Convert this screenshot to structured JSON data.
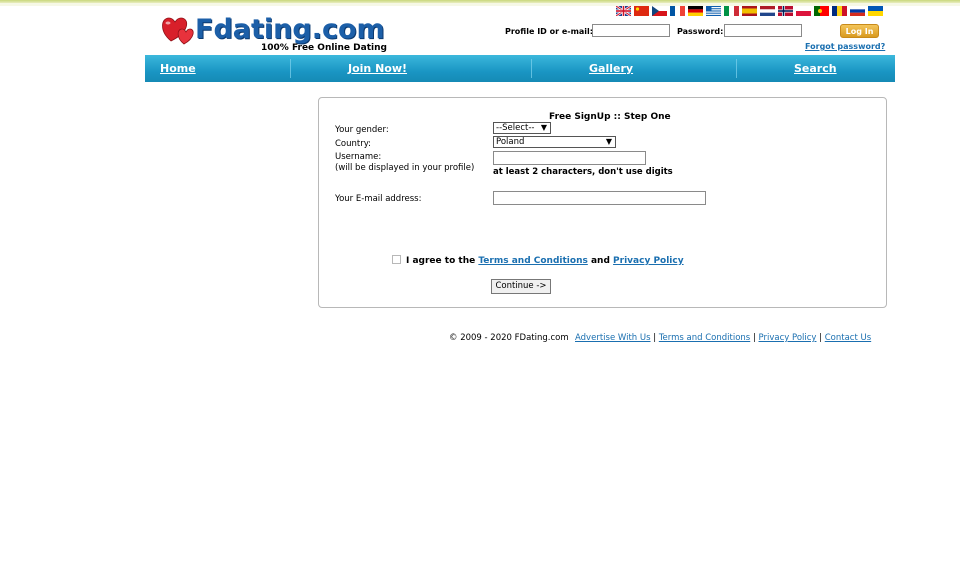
{
  "brand": {
    "logo_text": "Fdating.com",
    "tagline": "100% Free Online Dating"
  },
  "languages": [
    {
      "name": "english-flag-icon",
      "colors": [
        "#1d3f8f",
        "#ffffff",
        "#cf142b"
      ]
    },
    {
      "name": "chinese-flag-icon",
      "colors": [
        "#de2910",
        "#ffde00"
      ]
    },
    {
      "name": "czech-flag-icon",
      "colors": [
        "#ffffff",
        "#d7141a",
        "#11457e"
      ]
    },
    {
      "name": "french-flag-icon",
      "colors": [
        "#0055a4",
        "#ffffff",
        "#ef4135"
      ]
    },
    {
      "name": "german-flag-icon",
      "colors": [
        "#000000",
        "#dd0000",
        "#ffce00"
      ]
    },
    {
      "name": "greek-flag-icon",
      "colors": [
        "#0d5eaf",
        "#ffffff"
      ]
    },
    {
      "name": "italian-flag-icon",
      "colors": [
        "#009246",
        "#ffffff",
        "#ce2b37"
      ]
    },
    {
      "name": "spanish-flag-icon",
      "colors": [
        "#aa151b",
        "#f1bf00",
        "#aa151b"
      ]
    },
    {
      "name": "dutch-flag-icon",
      "colors": [
        "#ae1c28",
        "#ffffff",
        "#21468b"
      ]
    },
    {
      "name": "norwegian-flag-icon",
      "colors": [
        "#ba0c2f",
        "#ffffff",
        "#00205b"
      ]
    },
    {
      "name": "polish-flag-icon",
      "colors": [
        "#ffffff",
        "#dc143c"
      ]
    },
    {
      "name": "portuguese-flag-icon",
      "colors": [
        "#006600",
        "#ff0000"
      ]
    },
    {
      "name": "romanian-flag-icon",
      "colors": [
        "#002b7f",
        "#fcd116",
        "#ce1126"
      ]
    },
    {
      "name": "russian-flag-icon",
      "colors": [
        "#ffffff",
        "#0039a6",
        "#d52b1e"
      ]
    },
    {
      "name": "ukrainian-flag-icon",
      "colors": [
        "#0057b7",
        "#ffd700"
      ]
    }
  ],
  "login": {
    "profile_label": "Profile ID or e-mail:",
    "password_label": "Password:",
    "button_label": "Log In",
    "forgot_label": "Forgot password?"
  },
  "nav": {
    "home": "Home",
    "join": "Join Now!",
    "gallery": "Gallery",
    "search": "Search"
  },
  "signup": {
    "title": "Free SignUp :: Step One",
    "gender_label": "Your gender:",
    "gender_value": "--Select--",
    "country_label": "Country:",
    "country_value": "Poland",
    "username_label": "Username:",
    "username_note": "(will be displayed in your profile)",
    "username_hint": "at least 2 characters, don't use digits",
    "email_label": "Your E-mail address:",
    "agree_prefix": "I agree to the",
    "terms_link": "Terms and Conditions",
    "and_text": "and",
    "privacy_link": "Privacy Policy",
    "continue_label": "Continue ->"
  },
  "footer": {
    "copyright": "© 2009 - 2020 FDating.com",
    "advertise": "Advertise With Us",
    "terms": "Terms and Conditions",
    "privacy": "Privacy Policy",
    "contact": "Contact Us",
    "separator": "|"
  },
  "colors": {
    "nav_blue": "#1a96c4",
    "link_blue": "#1a6fb0",
    "login_orange": "#e0a22c",
    "logo_blue": "#1c5fa8",
    "heart_red": "#d81f2a"
  }
}
